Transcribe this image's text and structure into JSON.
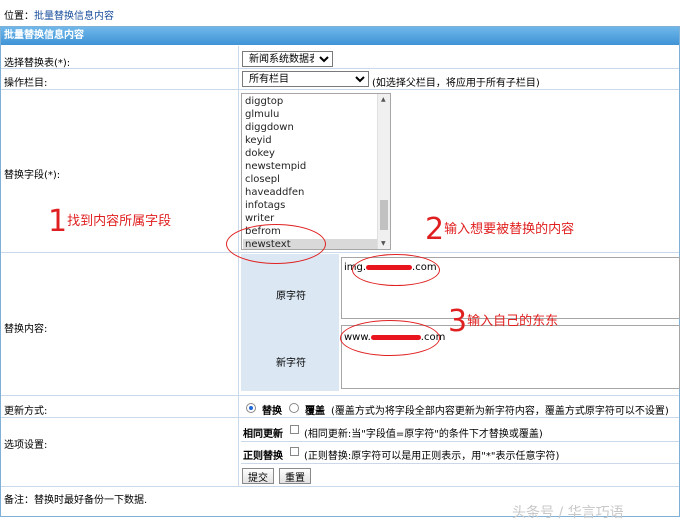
{
  "location": {
    "prefix": "位置：",
    "link": "批量替换信息内容"
  },
  "header": {
    "title": "批量替换信息内容"
  },
  "rows": {
    "table": {
      "label": "选择替换表(*):",
      "value": "新闻系统数据表"
    },
    "column": {
      "label": "操作栏目:",
      "value": "所有栏目",
      "hint": "(如选择父栏目，将应用于所有子栏目)"
    },
    "field": {
      "label": "替换字段(*):",
      "options": [
        "diggtop",
        "glmulu",
        "diggdown",
        "keyid",
        "dokey",
        "newstempid",
        "closepl",
        "haveaddfen",
        "infotags",
        "writer",
        "befrom",
        "newstext"
      ],
      "selected": "newstext"
    },
    "content": {
      "label": "替换内容:",
      "orig_label": "原字符",
      "orig_value": "img.[REDACTED].com",
      "orig_display_prefix": "img.",
      "orig_display_suffix": ".com",
      "new_label": "新字符",
      "new_display_prefix": "www.",
      "new_display_suffix": ".com"
    },
    "mode": {
      "label": "更新方式:",
      "replace": "替换",
      "cover": "覆盖",
      "hint": "(覆盖方式为将字段全部内容更新为新字符内容，覆盖方式原字符可以不设置)"
    },
    "options": {
      "label": "选项设置:",
      "related_label": "相同更新",
      "related_hint": "(相同更新:当\"字段值=原字符\"的条件下才替换或覆盖)",
      "regex_label": "正则替换",
      "regex_hint": "(正则替换:原字符可以是用正则表示，用\"*\"表示任意字符)"
    },
    "buttons": {
      "submit": "提交",
      "reset": "重置"
    }
  },
  "note": "备注：替换时最好备份一下数据.",
  "annotations": {
    "a1": "1找到内容所属字段",
    "a2": "2输入想要被替换的内容",
    "a3": "3输入自己的东东"
  },
  "watermark": "头条号 / 华言巧语",
  "colors": {
    "header": "#4a9ee0",
    "annotation": "#e02020",
    "shade": "#dbe8f4"
  }
}
